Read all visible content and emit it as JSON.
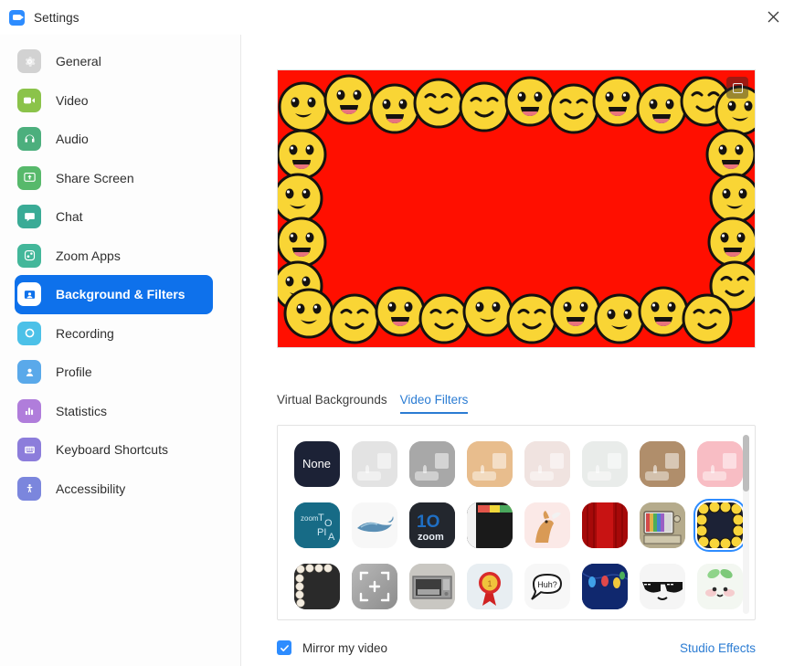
{
  "window": {
    "title": "Settings",
    "logo_icon": "zoom-camera-icon",
    "close_icon": "close-icon"
  },
  "sidebar": {
    "items": [
      {
        "label": "General",
        "icon": "gear-icon",
        "color": "#d2d2d2",
        "active": false
      },
      {
        "label": "Video",
        "icon": "video-camera-icon",
        "color": "#8bc34a",
        "active": false
      },
      {
        "label": "Audio",
        "icon": "headphones-icon",
        "color": "#4caf7d",
        "active": false
      },
      {
        "label": "Share Screen",
        "icon": "share-screen-icon",
        "color": "#57b96b",
        "active": false
      },
      {
        "label": "Chat",
        "icon": "chat-bubble-icon",
        "color": "#3aab96",
        "active": false
      },
      {
        "label": "Zoom Apps",
        "icon": "zoom-apps-icon",
        "color": "#43b79a",
        "active": false
      },
      {
        "label": "Background & Filters",
        "icon": "person-card-icon",
        "color": "#ffffff",
        "active": true
      },
      {
        "label": "Recording",
        "icon": "record-circle-icon",
        "color": "#4cc1e8",
        "active": false
      },
      {
        "label": "Profile",
        "icon": "person-icon",
        "color": "#5aa9ea",
        "active": false
      },
      {
        "label": "Statistics",
        "icon": "bar-chart-icon",
        "color": "#b07ddb",
        "active": false
      },
      {
        "label": "Keyboard Shortcuts",
        "icon": "keyboard-icon",
        "color": "#8c7ddb",
        "active": false
      },
      {
        "label": "Accessibility",
        "icon": "accessibility-icon",
        "color": "#7b86dd",
        "active": false
      }
    ],
    "active_color": "#0e71eb"
  },
  "preview": {
    "name": "video-preview",
    "background_color": "#ff0f00",
    "applied_filter": "Emoji Frame",
    "expand_icon": "expand-icon"
  },
  "tabs": [
    {
      "label": "Virtual Backgrounds",
      "active": false
    },
    {
      "label": "Video Filters",
      "active": true
    }
  ],
  "filters": {
    "accent_color": "#2d8cff",
    "scrollbar_position": "top",
    "items": [
      {
        "name": "None",
        "art": "none",
        "color": "#1c2236",
        "selected": false
      },
      {
        "name": "Light Grey Tone",
        "art": "room",
        "color": "#e3e3e3",
        "selected": false
      },
      {
        "name": "Grey Tone",
        "art": "room",
        "color": "#a8a8a8",
        "selected": false
      },
      {
        "name": "Warm Tan Tone",
        "art": "room",
        "color": "#e8bd8d",
        "selected": false
      },
      {
        "name": "Soft Blush Tone",
        "art": "room",
        "color": "#f0e3e0",
        "selected": false
      },
      {
        "name": "Cool White Tone",
        "art": "room",
        "color": "#e9ecea",
        "selected": false
      },
      {
        "name": "Deep Brown Tone",
        "art": "room",
        "color": "#b08e6b",
        "selected": false
      },
      {
        "name": "Pink Tone",
        "art": "room",
        "color": "#f8bdc4",
        "selected": false
      },
      {
        "name": "Zoomtopia",
        "art": "zoomtopia",
        "color": "#176b86",
        "selected": false
      },
      {
        "name": "Whale",
        "art": "whale",
        "color": "#f7f7f7",
        "selected": false
      },
      {
        "name": "10 Years of Zoom",
        "art": "ten-zoom",
        "color": "#23272e",
        "selected": false
      },
      {
        "name": "Rainbow Roll",
        "art": "rainbow",
        "color": "#1a1a1a",
        "selected": false
      },
      {
        "name": "Corgi",
        "art": "corgi",
        "color": "#fbe9e7",
        "selected": false
      },
      {
        "name": "Red Curtain",
        "art": "curtain",
        "color": "#c00d0d",
        "selected": false
      },
      {
        "name": "Retro TV",
        "art": "tv",
        "color": "#b5ab8c",
        "selected": false
      },
      {
        "name": "Emoji Frame",
        "art": "emoji",
        "color": "#f8d53b",
        "selected": true
      },
      {
        "name": "Pearls",
        "art": "pearls",
        "color": "#2a2a2a",
        "selected": false
      },
      {
        "name": "Focus Frame",
        "art": "focus",
        "color": "#9e9e9e",
        "selected": false
      },
      {
        "name": "Microwave",
        "art": "microwave",
        "color": "#c9c7c2",
        "selected": false
      },
      {
        "name": "Award Ribbon",
        "art": "ribbon",
        "color": "#e8eef2",
        "selected": false
      },
      {
        "name": "Huh? Bubble",
        "art": "huh",
        "color": "#f7f7f7",
        "selected": false
      },
      {
        "name": "Party Lights",
        "art": "lights",
        "color": "#0c1c5c",
        "selected": false
      },
      {
        "name": "Deal With It",
        "art": "sunglasses",
        "color": "#f5f5f5",
        "selected": false
      },
      {
        "name": "Sprout",
        "art": "sprout",
        "color": "#f3f7f1",
        "selected": false
      }
    ]
  },
  "bottom": {
    "mirror_label": "Mirror my video",
    "mirror_checked": true,
    "studio_effects_label": "Studio Effects"
  }
}
